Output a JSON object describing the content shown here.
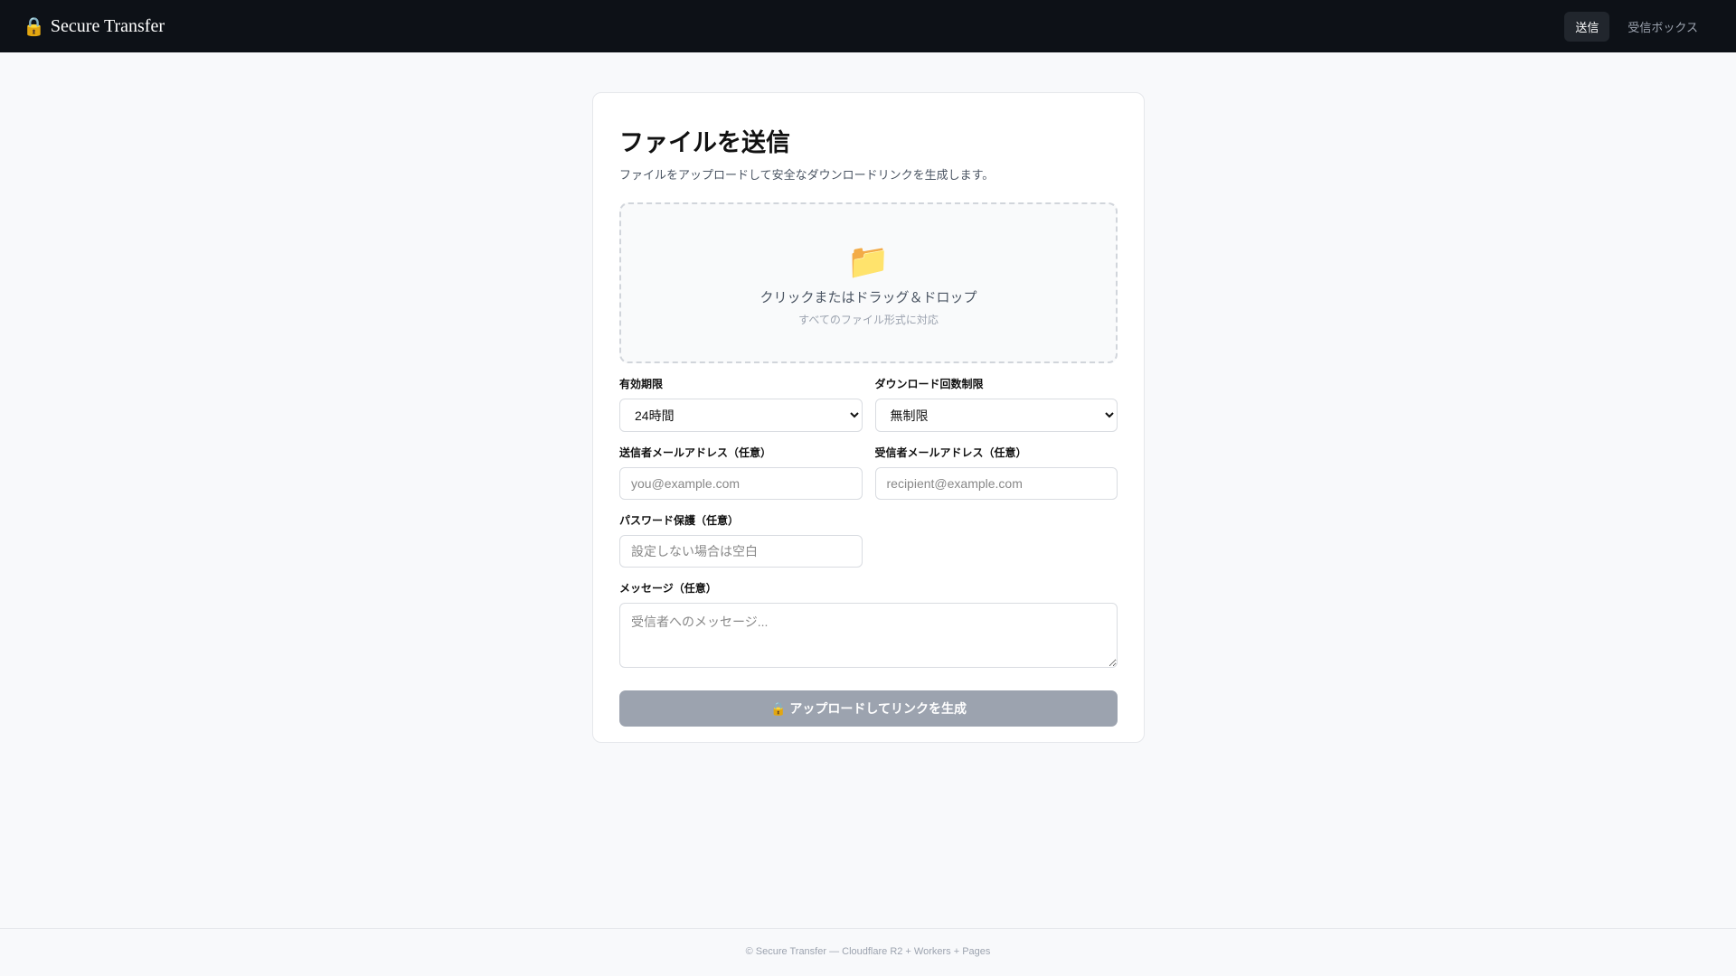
{
  "header": {
    "brand_icon": "lock-icon",
    "brand": "Secure Transfer",
    "nav": [
      {
        "label": "送信",
        "active": true
      },
      {
        "label": "受信ボックス",
        "active": false
      }
    ]
  },
  "main": {
    "title": "ファイルを送信",
    "subtitle": "ファイルをアップロードして安全なダウンロードリンクを生成します。",
    "dropzone": {
      "icon": "folder-icon",
      "text": "クリックまたはドラッグ＆ドロップ",
      "hint": "すべてのファイル形式に対応"
    },
    "expiry": {
      "label": "有効期限",
      "value": "24時間"
    },
    "download_limit": {
      "label": "ダウンロード回数制限",
      "value": "無制限"
    },
    "sender_email": {
      "label": "送信者メールアドレス（任意）",
      "placeholder": "you@example.com"
    },
    "recipient_email": {
      "label": "受信者メールアドレス（任意）",
      "placeholder": "recipient@example.com"
    },
    "password": {
      "label": "パスワード保護（任意）",
      "placeholder": "設定しない場合は空白"
    },
    "message": {
      "label": "メッセージ（任意）",
      "placeholder": "受信者へのメッセージ..."
    },
    "submit": {
      "icon": "🔒",
      "label": "アップロードしてリンクを生成"
    }
  },
  "footer": {
    "text": "© Secure Transfer — Cloudflare R2 + Workers + Pages"
  }
}
